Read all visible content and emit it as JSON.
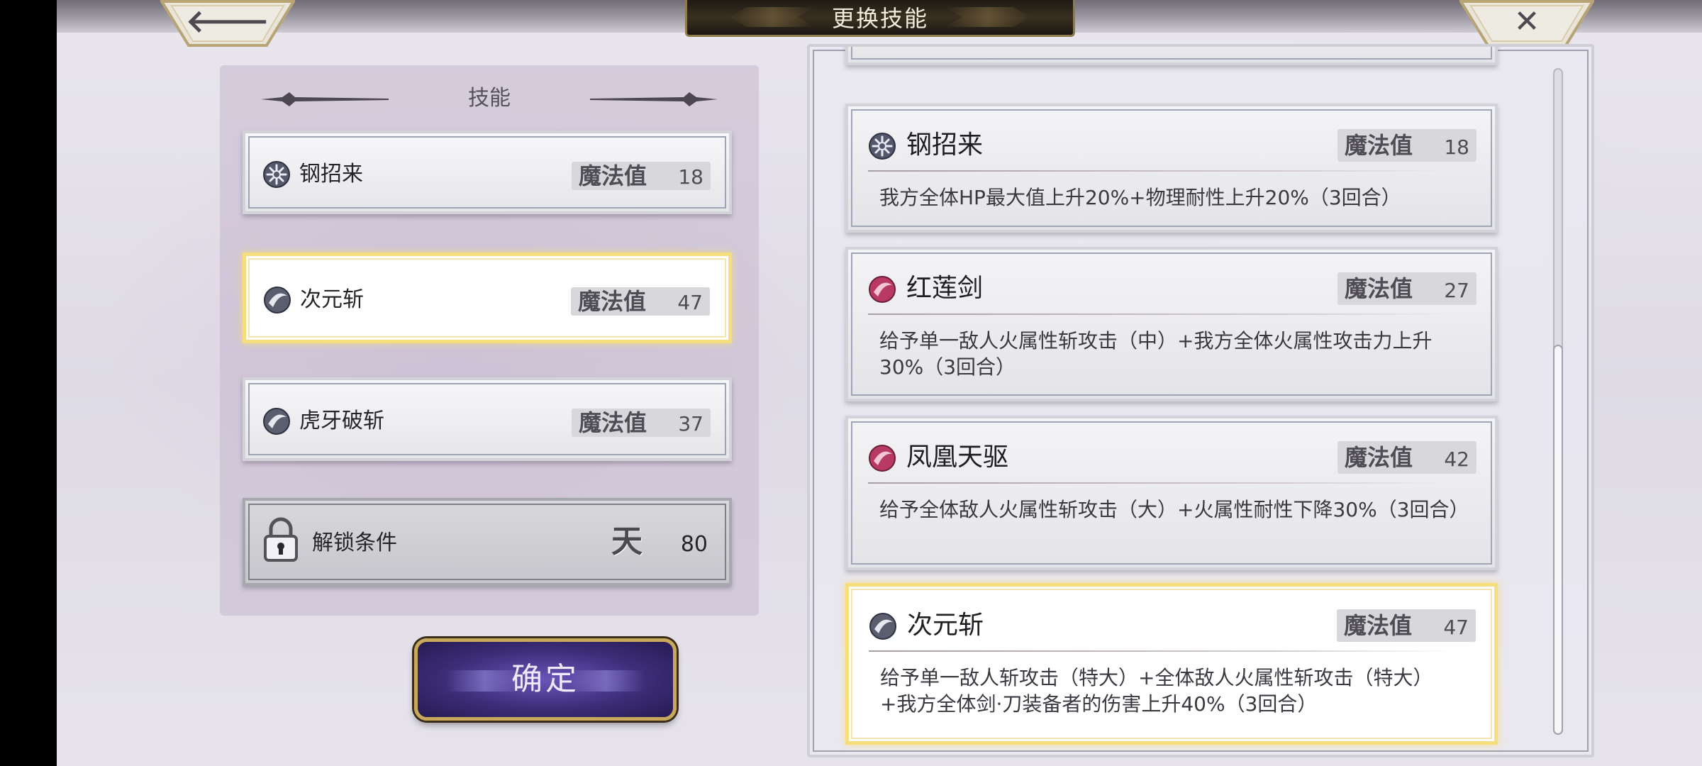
{
  "header": {
    "title": "更换技能",
    "back_glyph": "🡐",
    "close_glyph": "✕"
  },
  "left_panel": {
    "title": "技能",
    "slots": [
      {
        "name": "钢招来",
        "mp_label": "魔法值",
        "mp": "18",
        "icon": "steel-burst-icon"
      },
      {
        "name": "次元斩",
        "mp_label": "魔法值",
        "mp": "47",
        "icon": "void-slash-icon",
        "selected": true
      },
      {
        "name": "虎牙破斩",
        "mp_label": "魔法值",
        "mp": "37",
        "icon": "void-slash-icon"
      }
    ],
    "locked_slot": {
      "label": "解锁条件",
      "glyph": "天",
      "value": "80",
      "icon": "lock-icon"
    },
    "confirm_label": "确定"
  },
  "right_panel": {
    "skills": [
      {
        "name": "钢招来",
        "mp_label": "魔法值",
        "mp": "18",
        "icon": "steel-burst-icon",
        "desc": "我方全体HP最大值上升20%+物理耐性上升20%（3回合）"
      },
      {
        "name": "红莲剑",
        "mp_label": "魔法值",
        "mp": "27",
        "icon": "fire-slash-icon",
        "desc": "给予单一敌人火属性斩攻击（中）+我方全体火属性攻击力上升30%（3回合）"
      },
      {
        "name": "凤凰天驱",
        "mp_label": "魔法值",
        "mp": "42",
        "icon": "fire-slash-icon",
        "desc": "给予全体敌人火属性斩攻击（大）+火属性耐性下降30%（3回合）"
      },
      {
        "name": "次元斩",
        "mp_label": "魔法值",
        "mp": "47",
        "icon": "void-slash-icon",
        "selected": true,
        "desc": "给予单一敌人斩攻击（特大）+全体敌人火属性斩攻击（特大）+我方全体剑·刀装备者的伤害上升40%（3回合）"
      }
    ]
  },
  "colors": {
    "selected_border": "#f6dd7d",
    "fire_icon": "#c0406a",
    "void_icon": "#5a5e6e",
    "confirm_bg": "#3c2d78"
  }
}
